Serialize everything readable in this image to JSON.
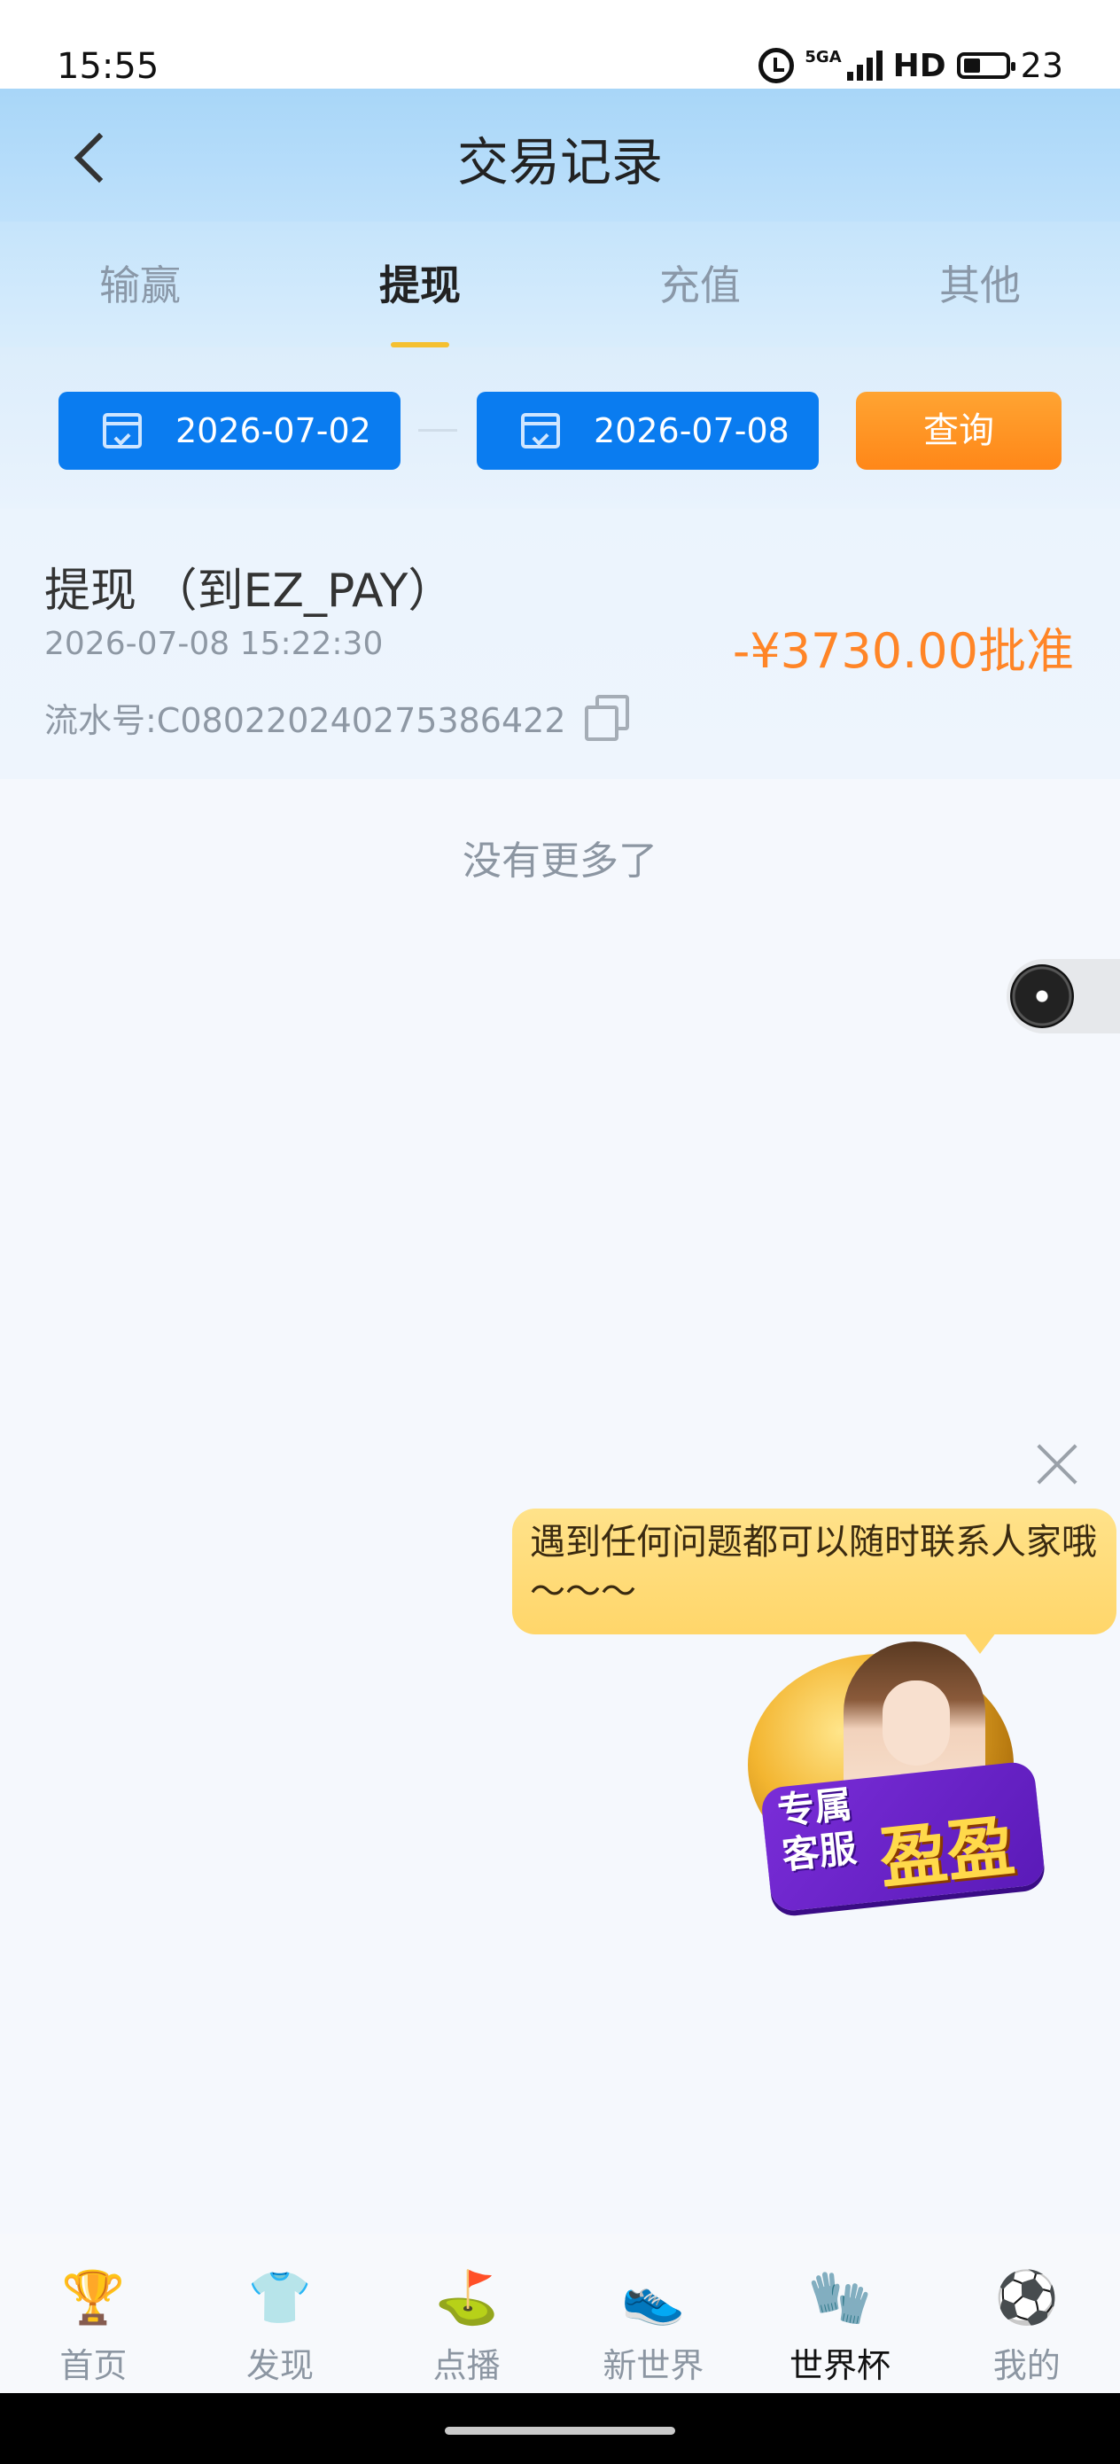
{
  "status_bar": {
    "time": "15:55",
    "network": "5GA",
    "hd": "HD",
    "battery": "23"
  },
  "header": {
    "title": "交易记录"
  },
  "tabs": [
    {
      "label": "输赢",
      "active": false
    },
    {
      "label": "提现",
      "active": true
    },
    {
      "label": "充值",
      "active": false
    },
    {
      "label": "其他",
      "active": false
    }
  ],
  "filter": {
    "start_date": "2026-07-02",
    "end_date": "2026-07-08",
    "query_label": "查询"
  },
  "record": {
    "title": "提现 （到EZ_PAY）",
    "time": "2026-07-08 15:22:30",
    "serial": "流水号:C08022024027538642​2",
    "amount_status": "-¥3730.00批准"
  },
  "no_more": "没有更多了",
  "support": {
    "bubble_text": "遇到任何问题都可以随时联系人家哦～～～",
    "badge_small": "专属客服",
    "badge_big": "盈盈"
  },
  "bottom_nav": [
    {
      "label": "首页",
      "icon": "trophy-icon",
      "glyph": "🏆",
      "active": false
    },
    {
      "label": "发现",
      "icon": "jersey-icon",
      "glyph": "👕",
      "active": false
    },
    {
      "label": "点播",
      "icon": "pitch-flag-icon",
      "glyph": "⛳",
      "active": false
    },
    {
      "label": "新世界",
      "icon": "boots-icon",
      "glyph": "👟",
      "active": false
    },
    {
      "label": "世界杯",
      "icon": "goalkeeper-gloves-icon",
      "glyph": "🧤",
      "active": true
    },
    {
      "label": "我的",
      "icon": "football-icon",
      "glyph": "⚽",
      "active": false
    }
  ],
  "colors": {
    "accent_blue": "#0a7cf0",
    "accent_orange": "#ff8527",
    "tab_indicator": "#f5c030"
  }
}
